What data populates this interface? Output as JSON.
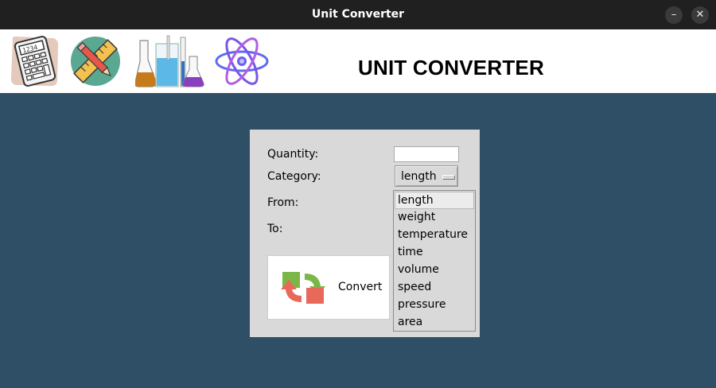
{
  "window": {
    "title": "Unit Converter",
    "minimize_glyph": "–",
    "close_glyph": "✕"
  },
  "header": {
    "heading": "UNIT CONVERTER",
    "icons": [
      "calculator-icon",
      "pencil-ruler-icon",
      "lab-flasks-icon",
      "atom-icon"
    ]
  },
  "form": {
    "quantity_label": "Quantity:",
    "quantity_value": "",
    "category_label": "Category:",
    "category_selected": "length",
    "from_label": "From:",
    "to_label": "To:",
    "convert_label": "Convert"
  },
  "dropdown": {
    "options": [
      "length",
      "weight",
      "temperature",
      "time",
      "volume",
      "speed",
      "pressure",
      "area"
    ],
    "highlighted": "length"
  },
  "colors": {
    "window_bg": "#2f4f66",
    "titlebar_bg": "#202020",
    "panel_bg": "#d9d9d9",
    "convert_green": "#7ab648",
    "convert_red": "#e8685a"
  }
}
